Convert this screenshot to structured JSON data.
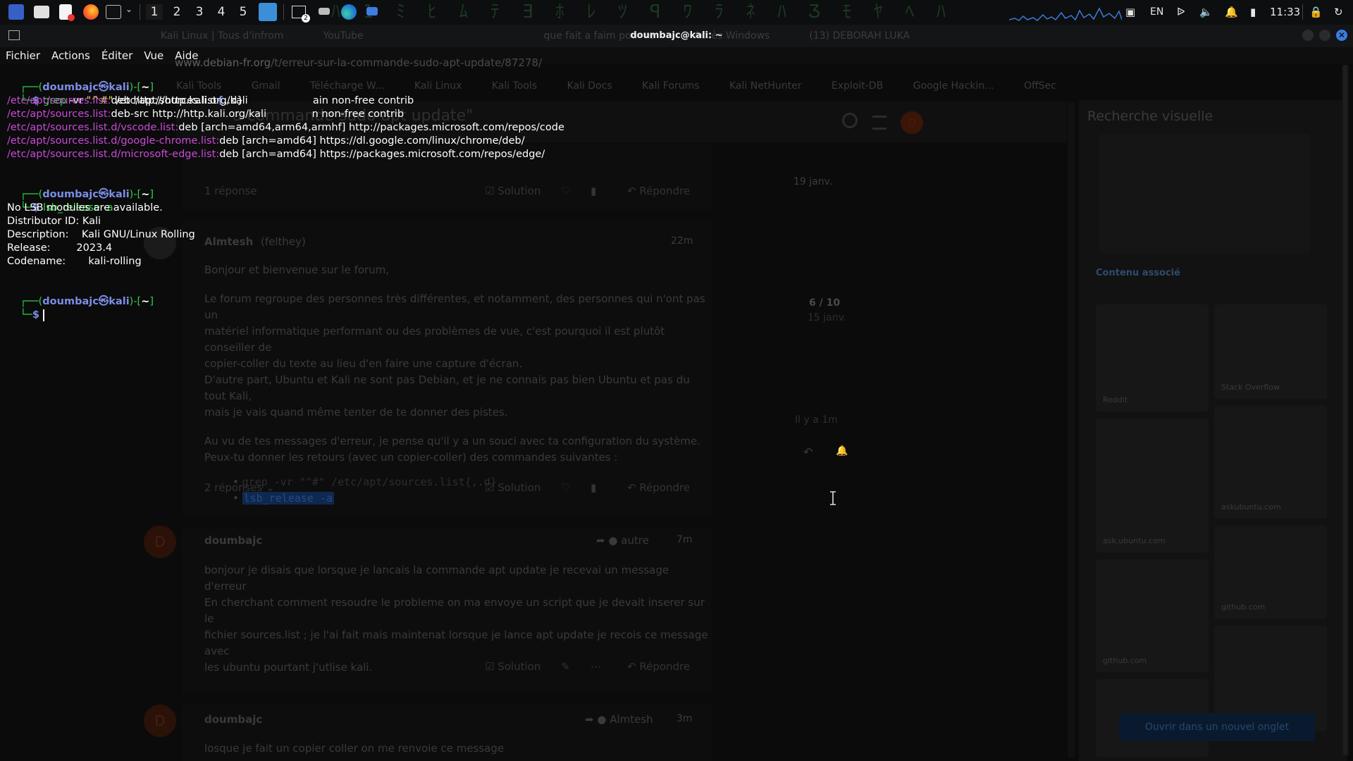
{
  "panel": {
    "workspaces": [
      "1",
      "2",
      "3",
      "4",
      "5"
    ],
    "terminal_badge": "2",
    "lang": "EN",
    "clock": "11:33"
  },
  "window": {
    "title": "doumbajc@kali: ~",
    "ghost_tabs": [
      "Kali Linux | Tous d'infrom",
      "YouTube",
      "que fait a faim pour re",
      "Accès Windows",
      "(13) DEBORAH LUKA"
    ]
  },
  "menu": [
    "Fichier",
    "Actions",
    "Éditer",
    "Vue",
    "Aide"
  ],
  "terminal": {
    "prompt_user": "doumbajc㉿kali",
    "prompt_dir": "~",
    "cmd1_grep": "grep",
    "cmd1_flag": " -vr ",
    "cmd1_pattern": "\"^#\"",
    "cmd1_path_a": " /etc/apt/sources.list",
    "cmd1_path_b": "{",
    "cmd1_path_c": ",.d}",
    "out1": [
      {
        "file": "/etc/apt/sources.list:",
        "line": "deb http://http.kali.org/kali                    ain non-free contrib"
      },
      {
        "file": "/etc/apt/sources.list:",
        "line": "deb-src http://http.kali.org/kali              n non-free contrib"
      },
      {
        "file": "/etc/apt/sources.list.d/vscode.list:",
        "line": "deb [arch=amd64,arm64,armhf] http://packages.microsoft.com/repos/code"
      },
      {
        "file": "/etc/apt/sources.list.d/google-chrome.list:",
        "line": "deb [arch=amd64] https://dl.google.com/linux/chrome/deb/"
      },
      {
        "file": "/etc/apt/sources.list.d/microsoft-edge.list:",
        "line": "deb [arch=amd64] https://packages.microsoft.com/repos/edge/"
      }
    ],
    "cmd2": "lsb_release -a",
    "out2": [
      "No LSB modules are available.",
      "Distributor ID: Kali",
      "Description:    Kali GNU/Linux Rolling",
      "Release:        2023.4",
      "Codename:       kali-rolling"
    ]
  },
  "browser": {
    "url": "www.debian-fr.org",
    "url_rest": "/t/erreur-sur-la-commande-sudo-apt-update/87278/",
    "bookmarks": [
      "Kali Tools",
      "Gmail",
      "Télécharge W...",
      "Kali Linux",
      "Kali Tools",
      "Kali Docs",
      "Kali Forums",
      "Kali NetHunter",
      "Exploit-DB",
      "Google Hackin...",
      "OffSec"
    ],
    "topic_title": "a commande sudo apt update\"",
    "post_actions": {
      "replies1": "1 réponse",
      "solution": "Solution",
      "reply": "Répondre",
      "replies2": "2 réponses"
    },
    "dates": {
      "d1": "19 janv.",
      "d2": "22m",
      "progress": "6 / 10",
      "progress_date": "15 janv.",
      "ago": "Il y a 1m",
      "d3": "7m",
      "d4": "3m"
    },
    "author1": "Almtesh",
    "author1_handle": "(felthey)",
    "author2": "doumbajc",
    "reply_to1": "autre",
    "reply_to2": "Almtesh",
    "post1": [
      "Bonjour et bienvenue sur le forum,",
      "Le forum regroupe des personnes très différentes, et notamment, des personnes qui n'ont pas un",
      "matériel informatique performant ou des problèmes de vue, c'est pourquoi il est plutôt conseiller de",
      "copier-coller du texte au lieu d'en faire une capture d'écran.",
      "D'autre part, Ubuntu et Kali ne sont pas Debian, et je ne connais pas bien Ubuntu et pas du tout Kali,",
      "mais je vais quand même tenter de te donner des pistes.",
      "Au vu de tes messages d'erreur, je pense qu'il y a un souci avec ta configuration du système.",
      "Peux-tu donner les retours (avec un copier-coller) des commandes suivantes :"
    ],
    "code1": "grep -vr \"^#\" /etc/apt/sources.list{,.d}",
    "code2": "lsb_release -a",
    "post2": [
      "bonjour je disais que lorsque je lancais la commande apt update je recevai un message d'erreur",
      "En cherchant comment resoudre le probleme on ma envoye un script que je devait inserer sur le",
      "fichier sources.list ; je l'ai fait mais maintenat lorsque je lance apt update je recois ce message avec",
      "les ubuntu pourtant j'utlise kali."
    ],
    "post3": "losque je fait un copier coller on me renvoie ce message",
    "avatar_letter": "D"
  },
  "visual_search": {
    "title": "Recherche visuelle",
    "related": "Contenu associé",
    "sources": [
      "Reddit",
      "Stack Overflow",
      "ask.ubuntu.com",
      "askubuntu.com",
      "github.com",
      "github.com"
    ],
    "open_tab": "Ouvrir dans un nouvel onglet"
  }
}
